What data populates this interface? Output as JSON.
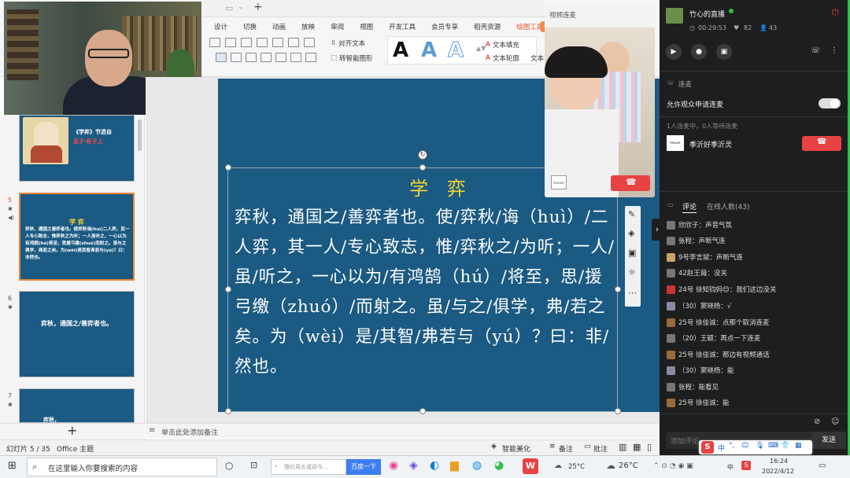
{
  "ribbon": {
    "tabs": [
      "设计",
      "切换",
      "动画",
      "放映",
      "审阅",
      "视图",
      "开发工具",
      "会员专享",
      "稻壳资源",
      "绘图工具"
    ],
    "active_tab": "绘图工具",
    "align_text": "对齐文本",
    "smart_shape": "转智能图形",
    "text_fill": "文本填充",
    "text_outline": "文本轮廓",
    "text_more": "文本",
    "style_letter": "A"
  },
  "webcam_top": {
    "label": "teacher-video"
  },
  "slides": {
    "thumb1_text": "《学弈》节选自",
    "thumb1_red": "孟子·告子上",
    "thumb2_title": "学 弈",
    "thumb2_text": "弈秋，通国之善弈者也。使弈秋诲(huì)二人弈，其一人专心致志，惟弈秋之为听；一人虽听之，一心以为有鸿鹄(hú)将至，思援弓缴(zhuó)而射之。虽与之俱学，弗若之矣。为(wèi)是其智弗若与(yú)？曰：非然也。",
    "thumb3_text": "弈秋，通国之/善弈者也。",
    "thumb4_text": "弈秋，",
    "nums": [
      "5",
      "6",
      "7"
    ]
  },
  "slide": {
    "title": "学 弈",
    "body": "弈秋，通国之/善弈者也。使/弈秋/诲（huì）/二人弈，其一人/专心致志，惟/弈秋之/为听；一人/虽/听之，一心以为/有鸿鹄（hú）/将至，思/援弓缴（zhuó）/而射之。虽/与之/俱学，弗/若之矣。为（wèi）是/其智/弗若与（yú）？曰：非/然也。"
  },
  "notes": {
    "placeholder": "单击此处添加备注"
  },
  "status": {
    "slide_info": "幻灯片 5 / 35",
    "theme": "Office 主题",
    "smart_beauty": "智能美化",
    "notes": "备注",
    "comments": "批注"
  },
  "video_call": {
    "label": "视频连麦",
    "badge": "PEELER"
  },
  "live": {
    "title": "竹心的直播",
    "duration": "00:29:53",
    "likes": "82",
    "viewers": "43",
    "connect_section": "连麦",
    "allow_label": "允许观众申请连麦",
    "queue_info": "1人连麦中，0人等待连麦",
    "connected_user": "季沂好季沂灵",
    "user_badge": "PEELER",
    "tabs": [
      "评论",
      "在线人数(43)"
    ],
    "comments": [
      "欣欣子：声音气氛",
      "张程：声断气连",
      "9号李言斌：声断气连",
      "42赵王薇：没关",
      "24号 徐知钧妈😊：我们这边没关",
      "（30）窦晓杨：√",
      "25号 徐佳诚：点那个取消连麦",
      "（20）王颖：再点一下连麦",
      "25号 徐佳诚：那边有视频通话",
      "（30）窦晓杨：能",
      "张程：能看见",
      "25号 徐佳诚：能"
    ],
    "comment_placeholder": "添加评论",
    "send": "发送",
    "accent": "#2fbf4a",
    "red": "#e84343"
  },
  "taskbar": {
    "search_placeholder": "在这里输入你要搜索的内容",
    "browser_search": "搜价周五或迎今...",
    "baidu_btn": "百度一下",
    "weather1": "25°C",
    "weather2": "26°C",
    "ime": "中",
    "time": "16:24",
    "date": "2022/4/12"
  }
}
